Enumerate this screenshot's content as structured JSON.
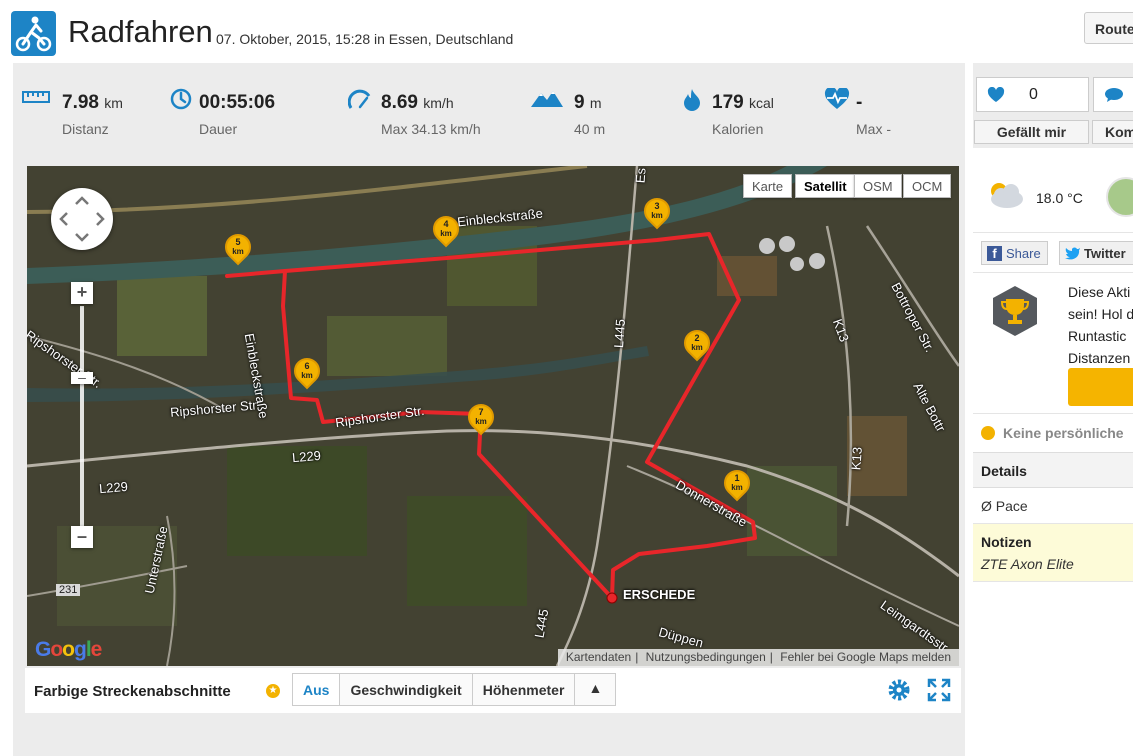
{
  "header": {
    "title": "Radfahren",
    "subtitle": "07. Oktober, 2015, 15:28 in Essen, Deutschland",
    "route_button": "Route"
  },
  "stats": [
    {
      "icon": "ruler-icon",
      "value": "7.98",
      "unit": "km",
      "label": "Distanz"
    },
    {
      "icon": "clock-icon",
      "value": "00:55:06",
      "unit": "",
      "label": "Dauer"
    },
    {
      "icon": "speedometer-icon",
      "value": "8.69",
      "unit": "km/h",
      "label": "Max 34.13 km/h"
    },
    {
      "icon": "mountain-icon",
      "value": "9",
      "unit": "m",
      "label": "40 m"
    },
    {
      "icon": "flame-icon",
      "value": "179",
      "unit": "kcal",
      "label": "Kalorien"
    },
    {
      "icon": "heartbeat-icon",
      "value": "-",
      "unit": "",
      "label": "Max -"
    }
  ],
  "social": {
    "like_count": "0",
    "like_button": "Gefällt mir",
    "comment_button": "Kom"
  },
  "map": {
    "types": [
      "Karte",
      "Satellit",
      "OSM",
      "OCM"
    ],
    "selected_type": "Satellit",
    "footer": [
      "Kartendaten",
      "Nutzungsbedingungen",
      "Fehler bei Google Maps melden"
    ],
    "logo": "Google",
    "place_labels": [
      "Ripshorster Str.",
      "Ripshorster Str.",
      "Ripshorster Str.",
      "Einbleckstraße",
      "Einbleckstraße",
      "L229",
      "L229",
      "L445",
      "L445",
      "K13",
      "K13",
      "Bottroper Str.",
      "Alte Bottr",
      "Donnerstraße",
      "ERSCHEDE",
      "Düppen",
      "Leimgardtsstr",
      "Unterstraße",
      "231",
      "Es"
    ],
    "km_markers": [
      {
        "num": "1",
        "unit": "km"
      },
      {
        "num": "2",
        "unit": "km"
      },
      {
        "num": "3",
        "unit": "km"
      },
      {
        "num": "4",
        "unit": "km"
      },
      {
        "num": "5",
        "unit": "km"
      },
      {
        "num": "6",
        "unit": "km"
      },
      {
        "num": "7",
        "unit": "km"
      }
    ],
    "route_color": "#e8262a"
  },
  "segments": {
    "title": "Farbige Streckenabschnitte",
    "tabs": [
      "Aus",
      "Geschwindigkeit",
      "Höhenmeter"
    ],
    "active_tab": "Aus",
    "collapse_symbol": "▲"
  },
  "weather": {
    "temperature": "18.0 °C"
  },
  "share": {
    "facebook": "Share",
    "twitter": "Twitter"
  },
  "promo": {
    "lines": [
      "Diese Akti",
      "sein! Hol d",
      "Runtastic",
      "Distanzen"
    ]
  },
  "records": {
    "text": "Keine persönliche"
  },
  "details": {
    "title": "Details",
    "pace_label": "Ø Pace"
  },
  "notes": {
    "title": "Notizen",
    "text": "ZTE Axon Elite"
  },
  "colors": {
    "accent": "#1d84c6",
    "route": "#e8262a",
    "marker": "#f3b200",
    "promo": "#f5b400"
  }
}
